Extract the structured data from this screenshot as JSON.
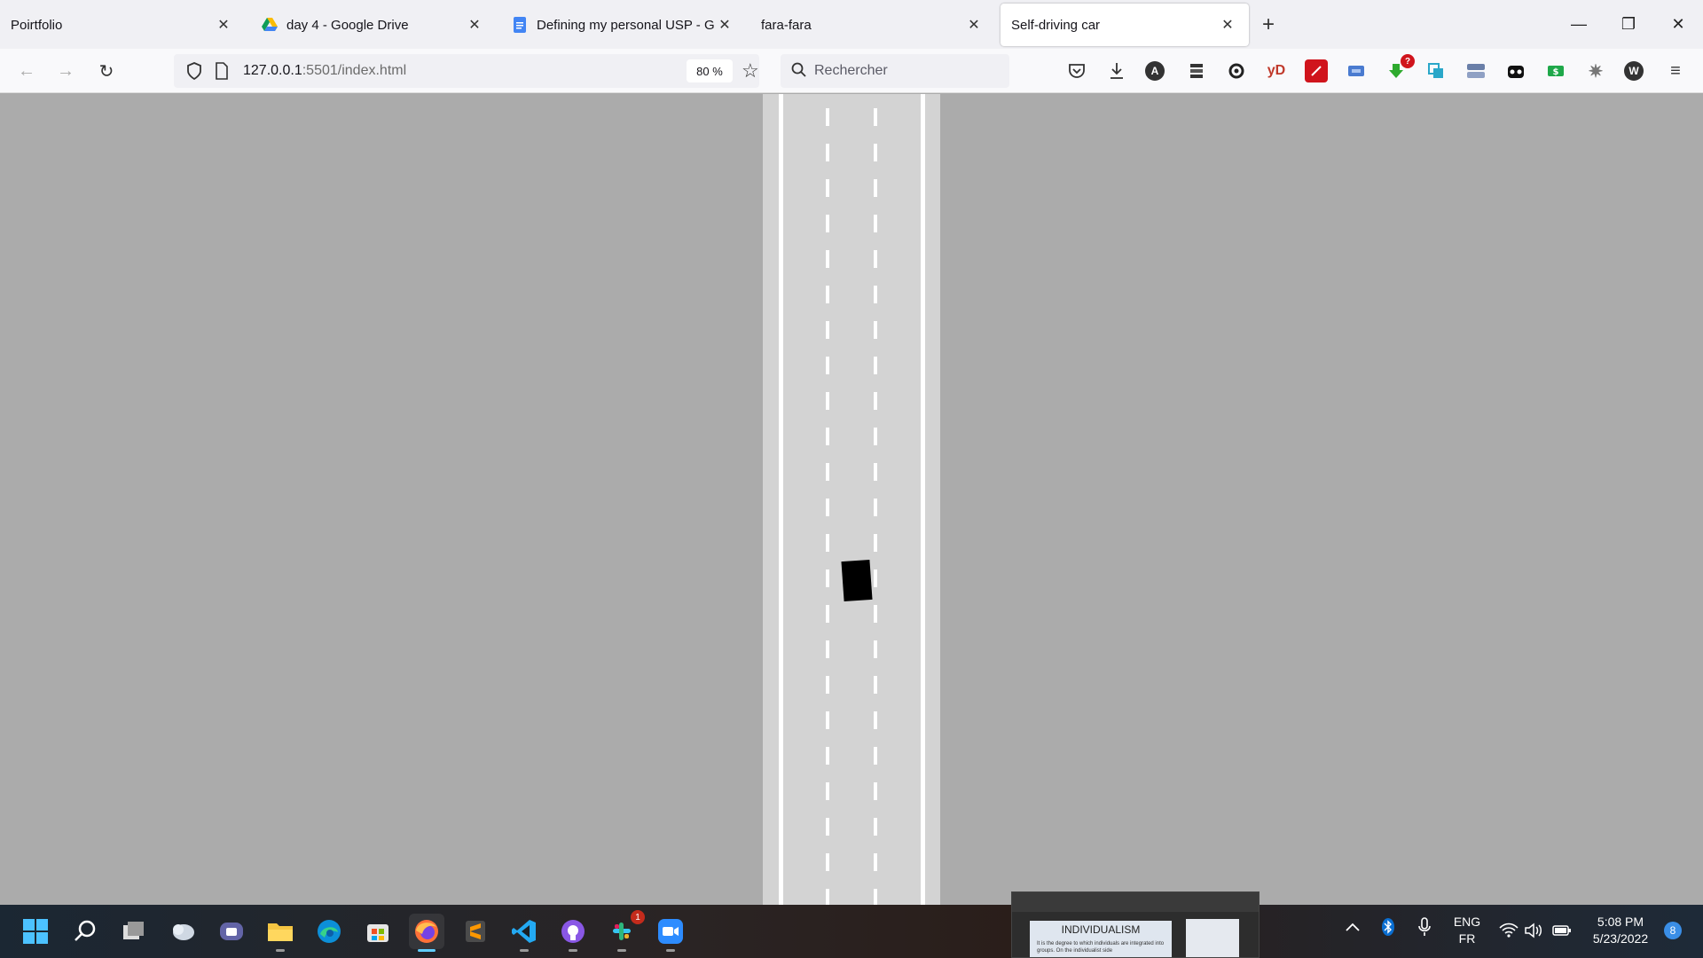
{
  "tabs": [
    {
      "title": "Poirtfolio",
      "active": false
    },
    {
      "title": "day 4 - Google Drive",
      "active": false
    },
    {
      "title": "Defining my personal USP - Goo",
      "active": false
    },
    {
      "title": "fara-fara",
      "active": false
    },
    {
      "title": "Self-driving car",
      "active": true
    }
  ],
  "navbar": {
    "url_host": "127.0.0.1",
    "url_path": ":5501/index.html",
    "zoom": "80 %",
    "search_placeholder": "Rechercher",
    "extensions": [
      "pocket-icon",
      "download-icon",
      "account-icon",
      "reader-icon",
      "sync-icon",
      "yd-icon",
      "pdf-icon",
      "screen-icon",
      "arrow-down-green-icon",
      "copy-icon",
      "toggle-icon",
      "bear-icon",
      "cash-icon",
      "settings-icon",
      "wordpress-icon",
      "menu-icon"
    ],
    "yd_label": "yD",
    "ext_badge": "?"
  },
  "simulation": {
    "road_lanes": 3,
    "car_color": "#000000"
  },
  "taskbar": {
    "apps": [
      "windows-start-icon",
      "search-icon",
      "task-view-icon",
      "widgets-icon",
      "teams-icon",
      "file-explorer-icon",
      "edge-icon",
      "store-icon",
      "firefox-icon",
      "sublime-icon",
      "vscode-icon",
      "github-icon",
      "slack-icon",
      "zoom-icon"
    ],
    "slack_badge": "1",
    "thumbnail_title": "INDIVIDUALISM",
    "thumbnail_text": "It is the degree to which individuals are integrated into groups. On the individualist side",
    "lang_primary": "ENG",
    "lang_secondary": "FR",
    "time": "5:08 PM",
    "date": "5/23/2022",
    "notification_count": "8"
  }
}
